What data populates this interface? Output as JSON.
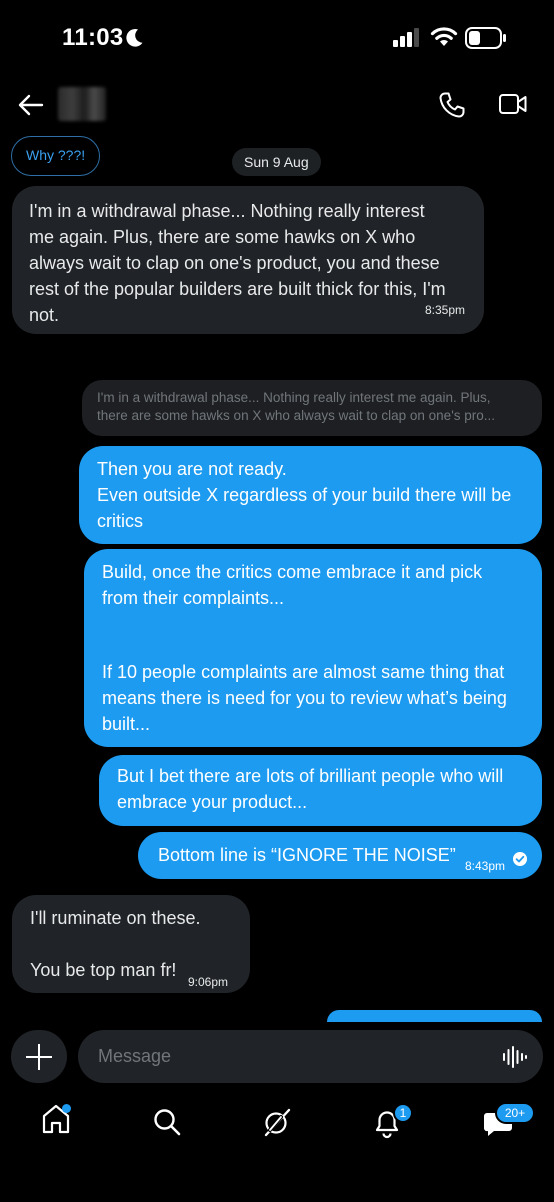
{
  "status_bar": {
    "time": "11:03"
  },
  "header": {
    "contact_name": ""
  },
  "conversation": {
    "pill_label": "Why ???!",
    "date_label": "Sun 9 Aug",
    "messages": [
      {
        "side": "received",
        "lines": [
          "I'm in a withdrawal phase... Nothing really interest",
          "me again. Plus, there are some hawks on X who",
          "always wait to clap on one's product, you and these",
          "rest of the popular builders are built thick for this, I'm",
          "not."
        ],
        "time": "8:35pm"
      },
      {
        "side": "quote",
        "lines": [
          "I'm in a withdrawal phase... Nothing really interest me again. Plus,",
          "there are some hawks on X who always wait to clap on one's pro..."
        ]
      },
      {
        "side": "sent",
        "lines": [
          "Then you are not ready.",
          "Even outside X regardless of your build there will be",
          "critics"
        ]
      },
      {
        "side": "sent",
        "lines": [
          "Build, once the critics come embrace it and pick",
          "from their complaints...",
          "",
          "If 10 people complaints are almost same thing that",
          "means there is need for you to review what’s being",
          "built..."
        ]
      },
      {
        "side": "sent",
        "lines": [
          "But I bet there are lots of brilliant people who will",
          "embrace your product..."
        ]
      },
      {
        "side": "sent",
        "lines": [
          "Bottom line is “IGNORE THE NOISE”"
        ],
        "time": "8:43pm",
        "status": "read"
      },
      {
        "side": "received",
        "lines": [
          "I'll ruminate on these.",
          "",
          "You be top man fr!"
        ],
        "time": "9:06pm"
      }
    ]
  },
  "composer": {
    "placeholder": "Message"
  },
  "nav": {
    "tabs": [
      {
        "name": "home",
        "icon": "home-icon",
        "has_dot": true
      },
      {
        "name": "search",
        "icon": "search-icon"
      },
      {
        "name": "grok",
        "icon": "grok-icon"
      },
      {
        "name": "notifications",
        "icon": "bell-icon",
        "badge": "1"
      },
      {
        "name": "messages",
        "icon": "message-icon",
        "badge": "20+"
      }
    ]
  },
  "colors": {
    "accent": "#1d9bf0",
    "received_bubble": "#202327",
    "background": "#000000",
    "muted": "#71767b"
  }
}
